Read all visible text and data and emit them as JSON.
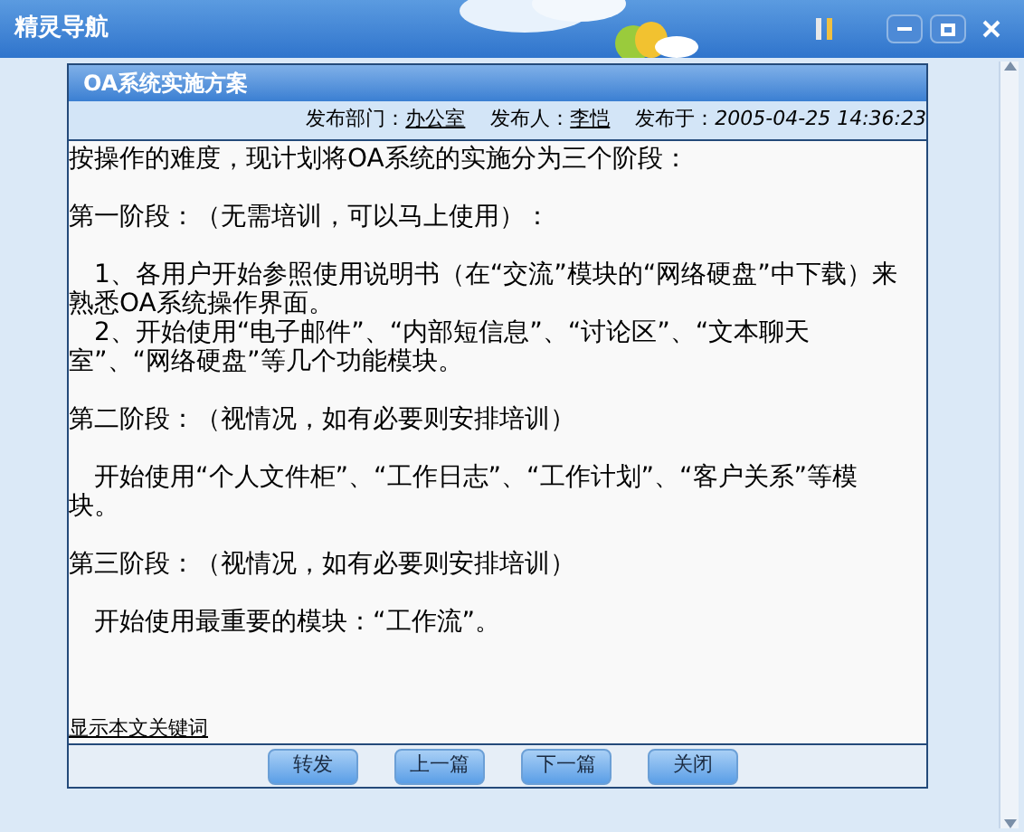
{
  "window": {
    "title": "精灵导航"
  },
  "article": {
    "title": "OA系统实施方案",
    "meta": [
      {
        "label": "发布部门：",
        "value": "办公室",
        "kind": "link"
      },
      {
        "label": "发布人：",
        "value": "李恺",
        "kind": "link"
      },
      {
        "label": "发布于：",
        "value": "2005-04-25 14:36:23",
        "kind": "date"
      }
    ],
    "paragraphs": [
      {
        "kind": "plain",
        "text": "按操作的难度，现计划将OA系统的实施分为三个阶段："
      },
      {
        "kind": "blank"
      },
      {
        "kind": "plain",
        "text": "第一阶段：（无需培训，可以马上使用）："
      },
      {
        "kind": "blank"
      },
      {
        "kind": "item",
        "text": "1、各用户开始参照使用说明书（在“交流”模块的“网络硬盘”中下载）来熟悉OA系统操作界面。"
      },
      {
        "kind": "item",
        "text": "2、开始使用“电子邮件”、“内部短信息”、“讨论区”、“文本聊天室”、“网络硬盘”等几个功能模块。"
      },
      {
        "kind": "blank"
      },
      {
        "kind": "plain",
        "text": "第二阶段：（视情况，如有必要则安排培训）"
      },
      {
        "kind": "blank"
      },
      {
        "kind": "item",
        "text": "开始使用“个人文件柜”、“工作日志”、“工作计划”、“客户关系”等模块。"
      },
      {
        "kind": "blank"
      },
      {
        "kind": "plain",
        "text": "第三阶段：（视情况，如有必要则安排培训）"
      },
      {
        "kind": "blank"
      },
      {
        "kind": "item",
        "text": "开始使用最重要的模块：“工作流”。"
      }
    ],
    "keywords_link": "显示本文关键词"
  },
  "buttons": [
    "转发",
    "上一篇",
    "下一篇",
    "关闭"
  ]
}
